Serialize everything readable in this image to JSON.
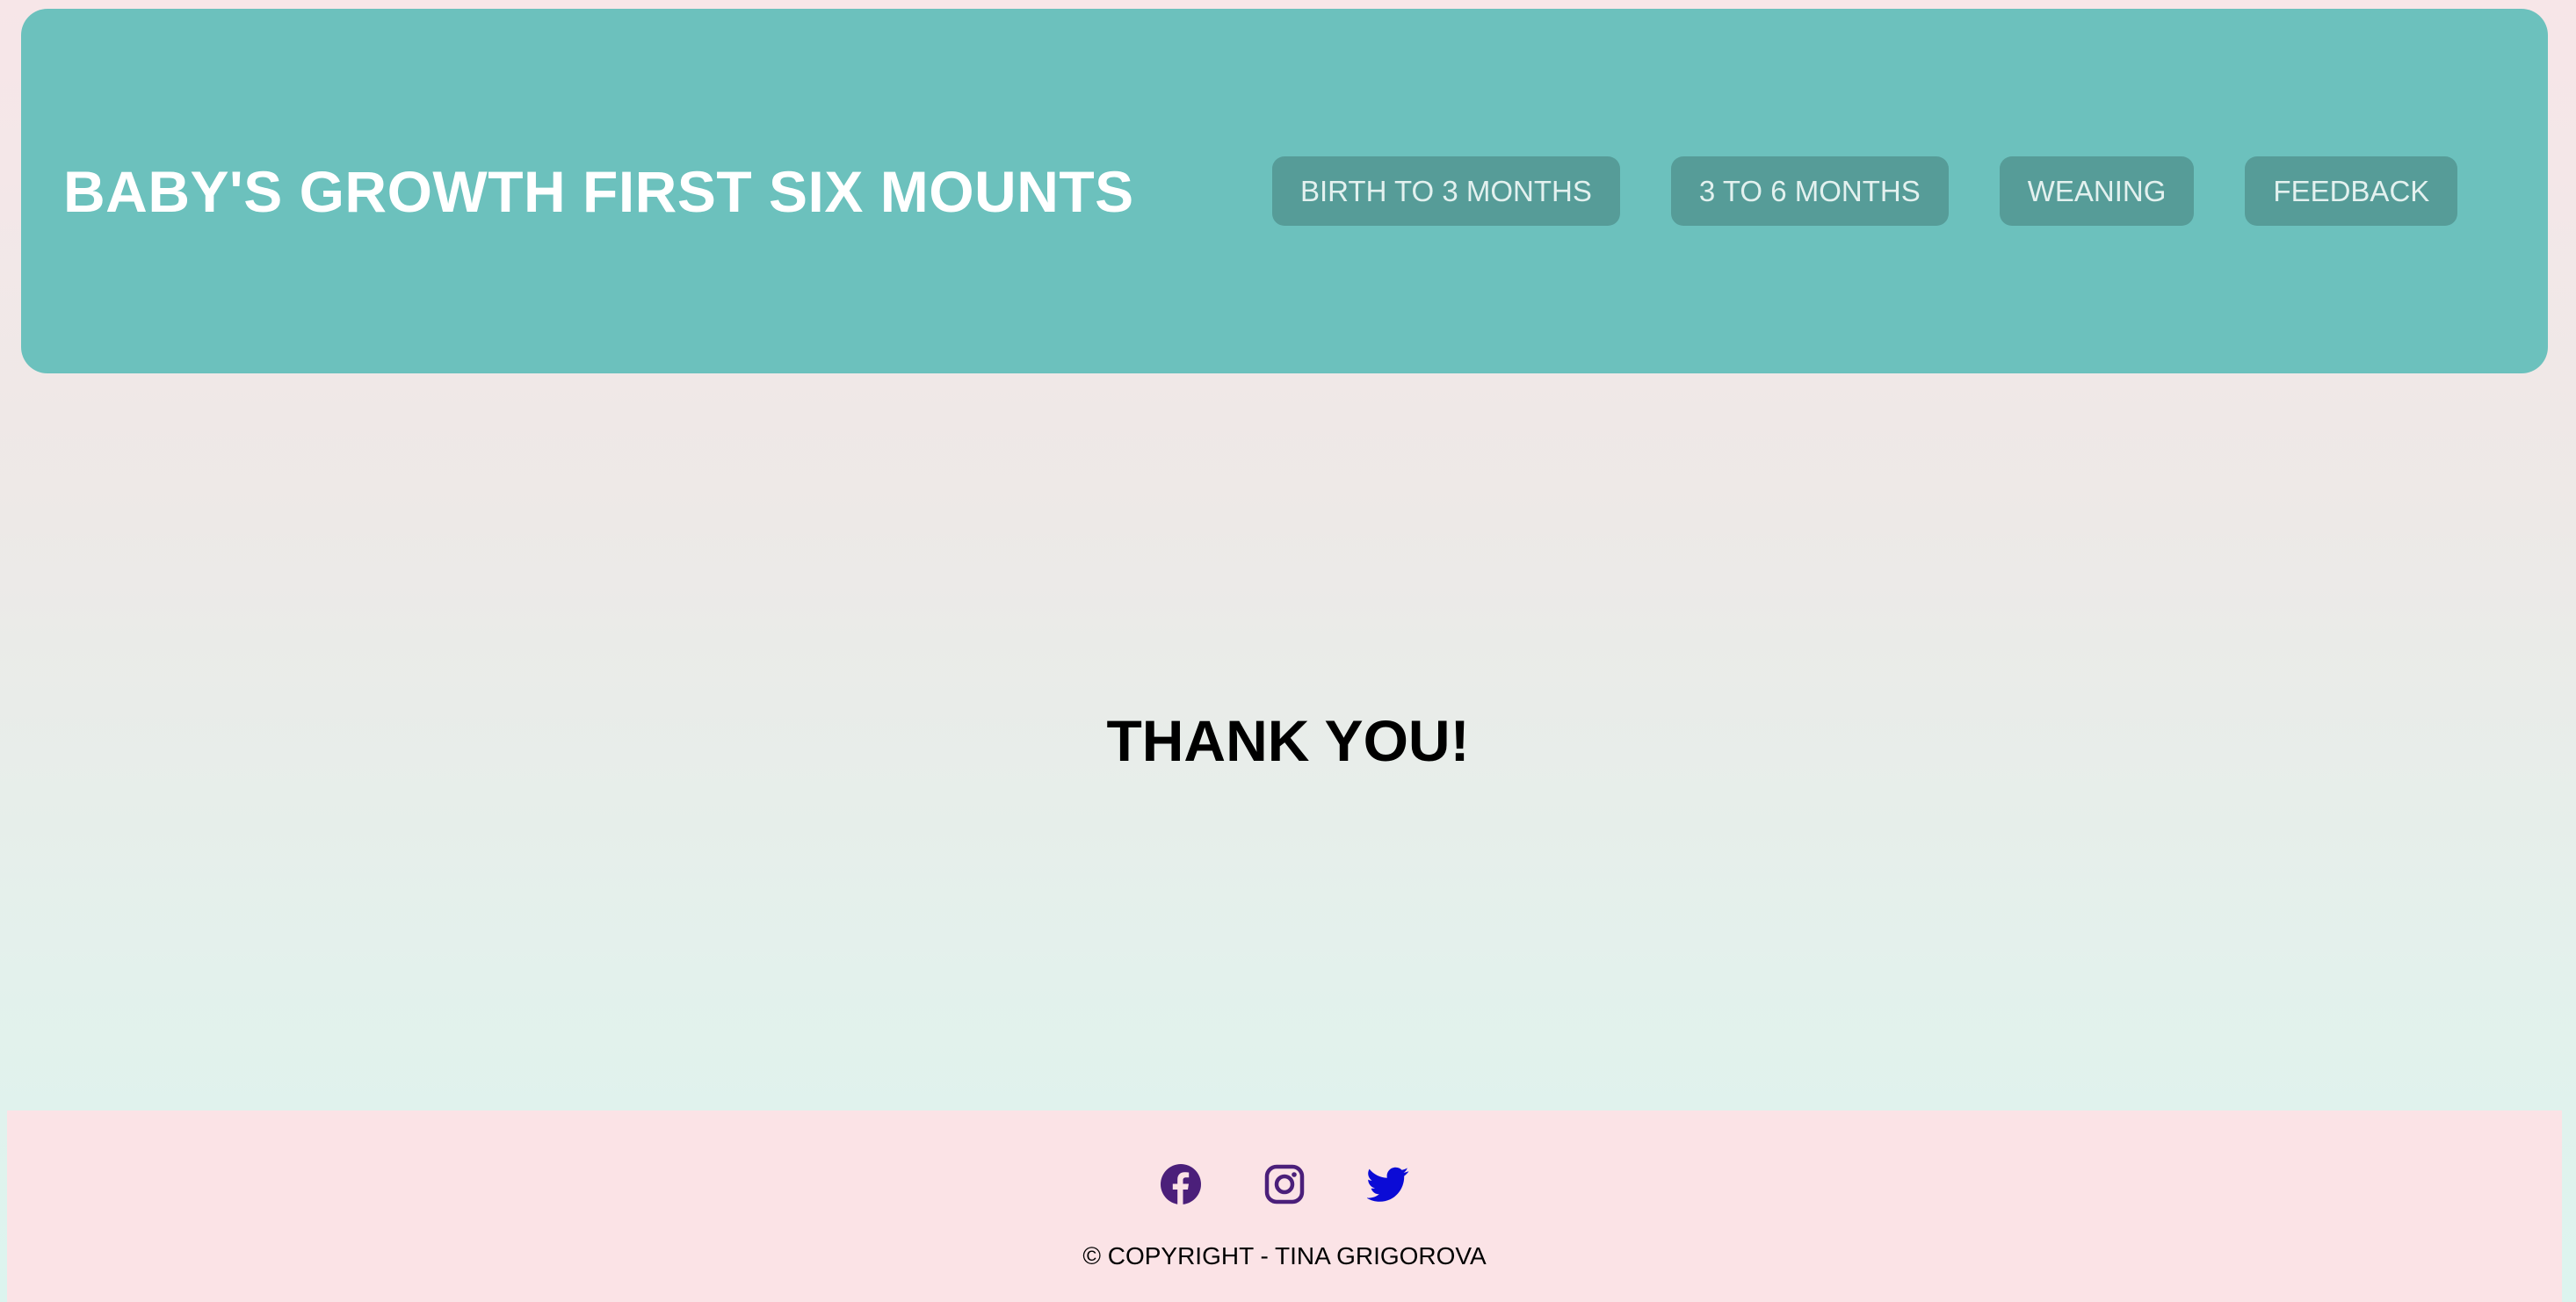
{
  "header": {
    "title": "BABY'S GROWTH FIRST SIX MOUNTS",
    "nav": [
      {
        "label": "BIRTH TO 3 MONTHS"
      },
      {
        "label": "3 TO 6 MONTHS"
      },
      {
        "label": "WEANING"
      },
      {
        "label": "FEEDBACK"
      }
    ]
  },
  "main": {
    "message": "THANK YOU!"
  },
  "footer": {
    "social": [
      {
        "icon": "facebook-icon",
        "color": "#4b1f7a"
      },
      {
        "icon": "instagram-icon",
        "color": "#4b1f7a"
      },
      {
        "icon": "twitter-icon",
        "color": "#0b0bd6"
      }
    ],
    "copyright": "© COPYRIGHT - TINA GRIGOROVA"
  },
  "colors": {
    "header_bg": "#6cc1bd",
    "nav_button_bg": "#569c98",
    "footer_bg": "#fbe3e6"
  }
}
